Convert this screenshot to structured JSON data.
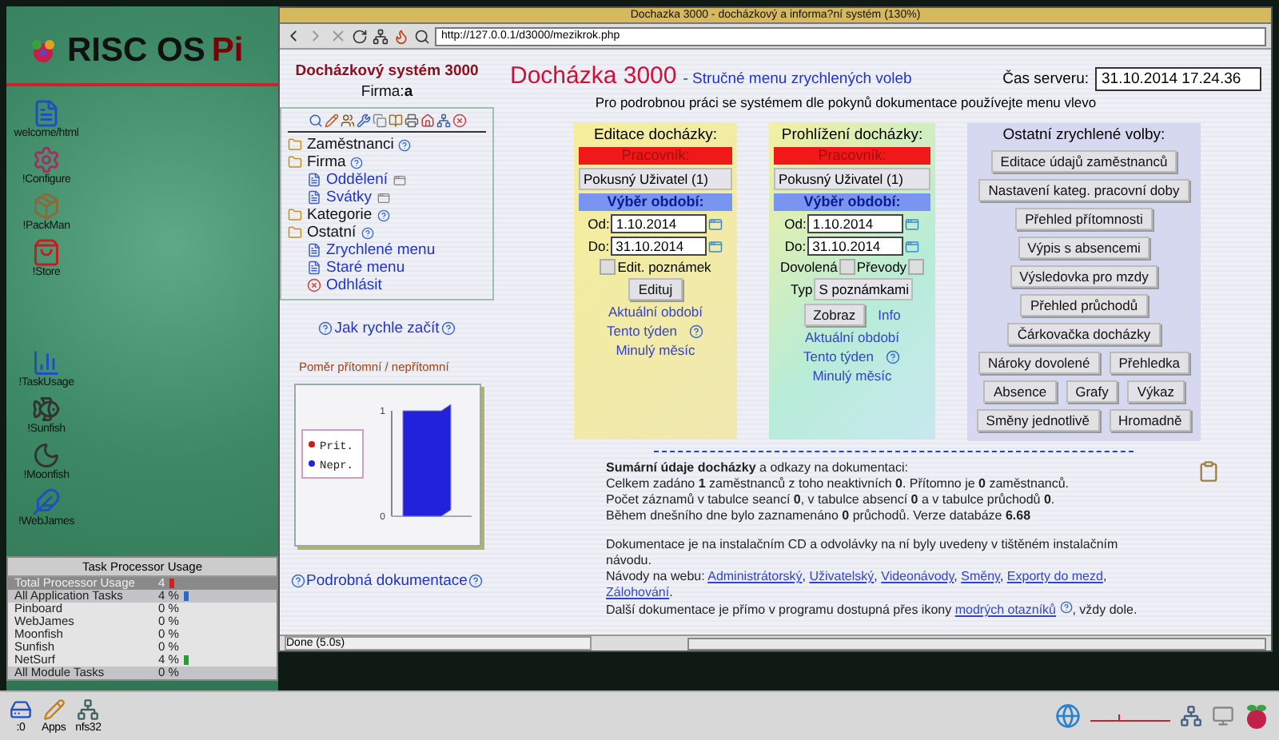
{
  "desktop": {
    "logo": "RISC OS",
    "logo_accent": "Pi",
    "icons": [
      {
        "label": "welcome/html",
        "kind": "doc"
      },
      {
        "label": "!Configure",
        "kind": "config"
      },
      {
        "label": "!PackMan",
        "kind": "pack"
      },
      {
        "label": "!Store",
        "kind": "store"
      },
      {
        "label": "!TaskUsage",
        "kind": "usage"
      },
      {
        "label": "!Sunfish",
        "kind": "fish"
      },
      {
        "label": "!Moonfish",
        "kind": "moon"
      },
      {
        "label": "!WebJames",
        "kind": "web"
      }
    ]
  },
  "task_usage": {
    "title": "Task Processor Usage",
    "rows": [
      {
        "name": "Total Processor Usage",
        "value": "4",
        "kind": "total",
        "bar": true
      },
      {
        "name": "All Application Tasks",
        "value": "4 %",
        "kind": "group",
        "bar": true
      },
      {
        "name": "Pinboard",
        "value": "0 %",
        "kind": "task",
        "bar": false
      },
      {
        "name": "WebJames",
        "value": "0 %",
        "kind": "task",
        "bar": false
      },
      {
        "name": "Moonfish",
        "value": "0 %",
        "kind": "task",
        "bar": false
      },
      {
        "name": "Sunfish",
        "value": "0 %",
        "kind": "task",
        "bar": false
      },
      {
        "name": "NetSurf",
        "value": "4 %",
        "kind": "task",
        "bar": true
      },
      {
        "name": "All Module Tasks",
        "value": "0 %",
        "kind": "group",
        "bar": false
      }
    ]
  },
  "browser": {
    "title": "Dochazka 3000 - docházkový a informa?ní systém  (130%)",
    "url": "http://127.0.0.1/d3000/mezikrok.php",
    "status": "Done (5.0s)",
    "sidebar": {
      "title": "Docházkový systém 3000",
      "company_label": "Firma:",
      "company": "a",
      "menu": [
        {
          "label": "Zaměstnanci",
          "kind": "folder"
        },
        {
          "label": "Firma",
          "kind": "folder"
        },
        {
          "label": "Oddělení",
          "kind": "page"
        },
        {
          "label": "Svátky",
          "kind": "page"
        },
        {
          "label": "Kategorie",
          "kind": "folder"
        },
        {
          "label": "Ostatní",
          "kind": "folder"
        },
        {
          "label": "Zrychlené menu",
          "kind": "link"
        },
        {
          "label": "Staré menu",
          "kind": "link"
        },
        {
          "label": "Odhlásit",
          "kind": "logout"
        }
      ],
      "quick_start": "Jak rychle začít",
      "chart": {
        "title": "Poměr přítomní / nepřítomní",
        "chart_data": {
          "type": "bar",
          "series": [
            {
              "name": "Prit.",
              "color": "#d01818",
              "values": [
                0
              ]
            },
            {
              "name": "Nepr.",
              "color": "#2222dd",
              "values": [
                1
              ]
            }
          ],
          "yticks": [
            0,
            1
          ],
          "ylim": [
            0,
            1
          ]
        }
      },
      "docs_link": "Podrobná dokumentace"
    },
    "header": {
      "title": "Docházka 3000",
      "subtitle": "- Stručné menu zrychlených voleb",
      "server_time_label": "Čas serveru:",
      "server_time": "31.10.2014 17.24.36",
      "instruction": "Pro podrobnou práci se systémem dle pokynů dokumentace používejte menu vlevo"
    },
    "edit_panel": {
      "title": "Editace docházky:",
      "worker_label": "Pracovník:",
      "worker": "Pokusný Uživatel (1)",
      "period_label": "Výběr období:",
      "from_label": "Od:",
      "from": "1.10.2014",
      "to_label": "Do:",
      "to": "31.10.2014",
      "checks": [
        {
          "label": "Edit. poznámek",
          "checked": false
        }
      ],
      "button": "Edituj",
      "links": [
        "Aktuální období",
        "Tento týden",
        "Minulý měsíc"
      ]
    },
    "view_panel": {
      "title": "Prohlížení docházky:",
      "worker_label": "Pracovník:",
      "worker": "Pokusný Uživatel (1)",
      "period_label": "Výběr období:",
      "from_label": "Od:",
      "from": "1.10.2014",
      "to_label": "Do:",
      "to": "31.10.2014",
      "checks": [
        {
          "label": "Dovolená",
          "checked": false
        },
        {
          "label": "Převody",
          "checked": false
        }
      ],
      "type_label": "Typ",
      "type": "S poznámkami",
      "button": "Zobraz",
      "info": "Info",
      "links": [
        "Aktuální období",
        "Tento týden",
        "Minulý měsíc"
      ]
    },
    "other_panel": {
      "title": "Ostatní zrychlené volby:",
      "button_lines": [
        {
          "buttons": [
            "Editace údajů zaměstnanců"
          ]
        },
        {
          "buttons": [
            "Nastavení kateg. pracovní doby"
          ]
        },
        {
          "buttons": [
            "Přehled přítomnosti"
          ]
        },
        {
          "buttons": [
            "Výpis s absencemi"
          ]
        },
        {
          "buttons": [
            "Výsledovka pro mzdy"
          ]
        },
        {
          "buttons": [
            "Přehled průchodů"
          ]
        },
        {
          "buttons": [
            "Čárkovačka docházky"
          ]
        },
        {
          "buttons": [
            "Nároky dovolené",
            "Přehledka"
          ]
        },
        {
          "buttons": [
            "Absence",
            "Grafy",
            "Výkaz"
          ]
        },
        {
          "buttons": [
            "Směny jednotlivě",
            "Hromadně"
          ]
        }
      ]
    },
    "summary": {
      "lines": [
        "**Sumární údaje docházky** a odkazy na dokumentaci:",
        "Celkem zadáno **1** zaměstnanců z toho neaktivních **0**. Přítomno je **0** zaměstnanců.",
        "Počet záznamů v tabulce seancí **0**, v tabulce absencí **0** a v tabulce průchodů **0**.",
        "Během dnešního dne bylo zaznamenáno **0** průchodů. Verze databáze **6.68**"
      ],
      "docs_text": "Dokumentace je na instalačním CD a odvolávky na ní byly uvedeny v tištěném instalačním návodu.",
      "web_label": "Návody na webu:",
      "web_links": [
        {
          "label": "Administrátorský",
          "after": ","
        },
        {
          "label": "Uživatelský",
          "after": ","
        },
        {
          "label": "Videonávody",
          "after": ","
        },
        {
          "label": "Směny",
          "after": ","
        },
        {
          "label": "Exporty do mezd",
          "after": ","
        },
        {
          "label": "Zálohování",
          "after": "."
        }
      ],
      "more_before": "Další dokumentace je přímo v programu dostupná přes ikony",
      "more_link": "modrých otazníků",
      "more_after": ", vždy dole."
    }
  },
  "taskbar": {
    "items": [
      {
        "label": ":0",
        "kind": "drive"
      },
      {
        "label": "Apps",
        "kind": "apps"
      },
      {
        "label": "nfs32",
        "kind": "network"
      }
    ]
  }
}
